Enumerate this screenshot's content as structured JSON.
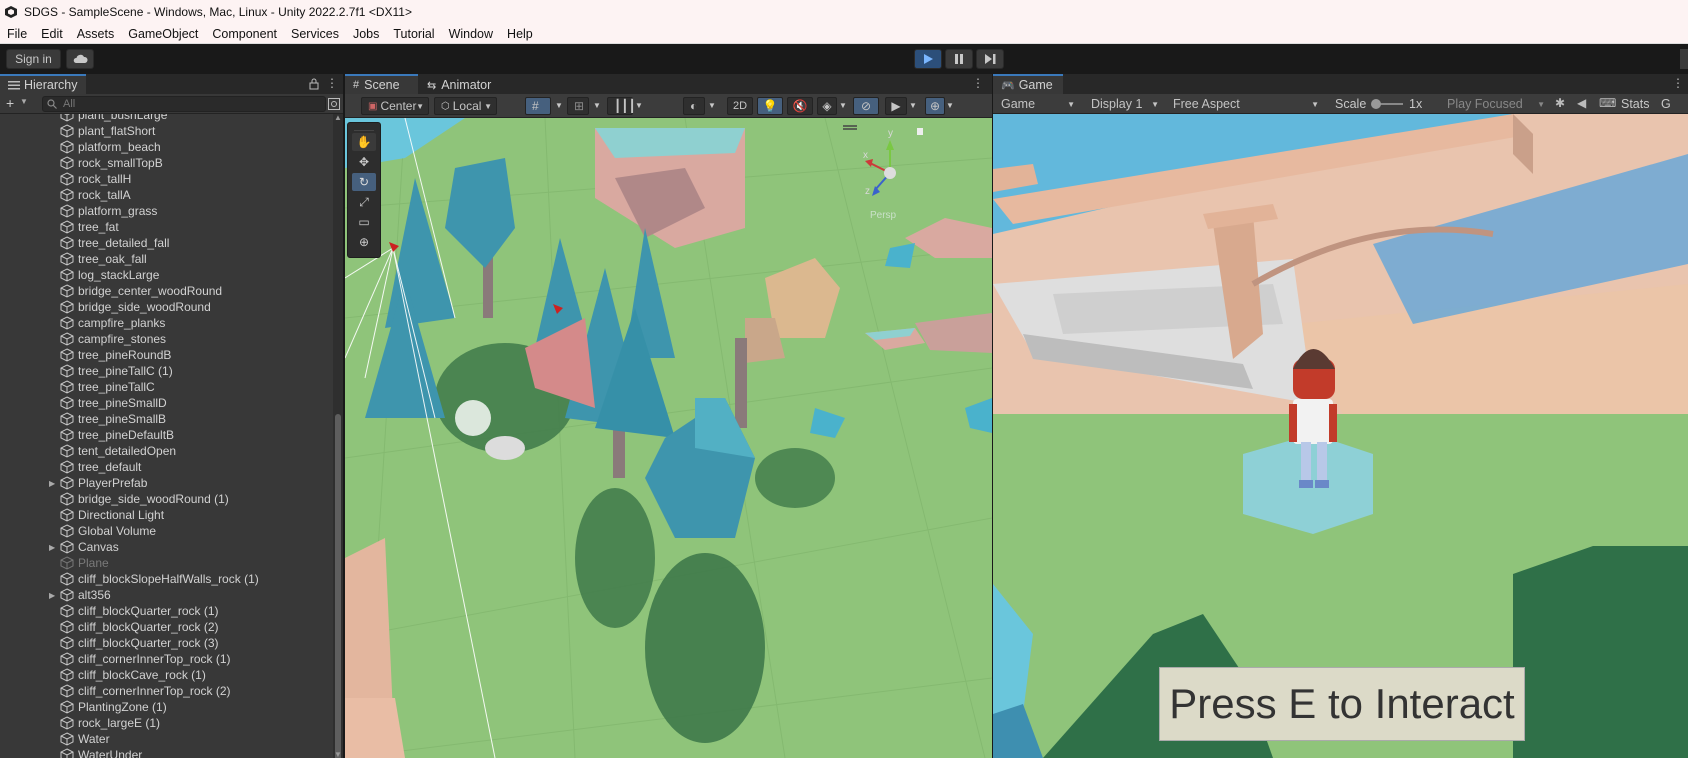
{
  "window": {
    "title": "SDGS - SampleScene - Windows, Mac, Linux - Unity 2022.2.7f1 <DX11>"
  },
  "menu": [
    "File",
    "Edit",
    "Assets",
    "GameObject",
    "Component",
    "Services",
    "Jobs",
    "Tutorial",
    "Window",
    "Help"
  ],
  "toolbar": {
    "sign_in": "Sign in"
  },
  "hierarchy": {
    "tab": "Hierarchy",
    "search_placeholder": "All",
    "items": [
      {
        "label": "plant_bushLarge",
        "expandable": false,
        "disabled": false
      },
      {
        "label": "plant_flatShort",
        "expandable": false,
        "disabled": false
      },
      {
        "label": "platform_beach",
        "expandable": false,
        "disabled": false
      },
      {
        "label": "rock_smallTopB",
        "expandable": false,
        "disabled": false
      },
      {
        "label": "rock_tallH",
        "expandable": false,
        "disabled": false
      },
      {
        "label": "rock_tallA",
        "expandable": false,
        "disabled": false
      },
      {
        "label": "platform_grass",
        "expandable": false,
        "disabled": false
      },
      {
        "label": "tree_fat",
        "expandable": false,
        "disabled": false
      },
      {
        "label": "tree_detailed_fall",
        "expandable": false,
        "disabled": false
      },
      {
        "label": "tree_oak_fall",
        "expandable": false,
        "disabled": false
      },
      {
        "label": "log_stackLarge",
        "expandable": false,
        "disabled": false
      },
      {
        "label": "bridge_center_woodRound",
        "expandable": false,
        "disabled": false
      },
      {
        "label": "bridge_side_woodRound",
        "expandable": false,
        "disabled": false
      },
      {
        "label": "campfire_planks",
        "expandable": false,
        "disabled": false
      },
      {
        "label": "campfire_stones",
        "expandable": false,
        "disabled": false
      },
      {
        "label": "tree_pineRoundB",
        "expandable": false,
        "disabled": false
      },
      {
        "label": "tree_pineTallC (1)",
        "expandable": false,
        "disabled": false
      },
      {
        "label": "tree_pineTallC",
        "expandable": false,
        "disabled": false
      },
      {
        "label": "tree_pineSmallD",
        "expandable": false,
        "disabled": false
      },
      {
        "label": "tree_pineSmallB",
        "expandable": false,
        "disabled": false
      },
      {
        "label": "tree_pineDefaultB",
        "expandable": false,
        "disabled": false
      },
      {
        "label": "tent_detailedOpen",
        "expandable": false,
        "disabled": false
      },
      {
        "label": "tree_default",
        "expandable": false,
        "disabled": false
      },
      {
        "label": "PlayerPrefab",
        "expandable": true,
        "disabled": false
      },
      {
        "label": "bridge_side_woodRound (1)",
        "expandable": false,
        "disabled": false
      },
      {
        "label": "Directional Light",
        "expandable": false,
        "disabled": false
      },
      {
        "label": "Global Volume",
        "expandable": false,
        "disabled": false
      },
      {
        "label": "Canvas",
        "expandable": true,
        "disabled": false
      },
      {
        "label": "Plane",
        "expandable": false,
        "disabled": true
      },
      {
        "label": "cliff_blockSlopeHalfWalls_rock (1)",
        "expandable": false,
        "disabled": false
      },
      {
        "label": "alt356",
        "expandable": true,
        "disabled": false
      },
      {
        "label": "cliff_blockQuarter_rock (1)",
        "expandable": false,
        "disabled": false
      },
      {
        "label": "cliff_blockQuarter_rock (2)",
        "expandable": false,
        "disabled": false
      },
      {
        "label": "cliff_blockQuarter_rock (3)",
        "expandable": false,
        "disabled": false
      },
      {
        "label": "cliff_cornerInnerTop_rock (1)",
        "expandable": false,
        "disabled": false
      },
      {
        "label": "cliff_blockCave_rock (1)",
        "expandable": false,
        "disabled": false
      },
      {
        "label": "cliff_cornerInnerTop_rock (2)",
        "expandable": false,
        "disabled": false
      },
      {
        "label": "PlantingZone (1)",
        "expandable": false,
        "disabled": false
      },
      {
        "label": "rock_largeE (1)",
        "expandable": false,
        "disabled": false
      },
      {
        "label": "Water",
        "expandable": false,
        "disabled": false
      },
      {
        "label": "WaterUnder",
        "expandable": false,
        "disabled": false
      }
    ]
  },
  "scene": {
    "tabs": [
      "Scene",
      "Animator"
    ],
    "pivot": "Center",
    "space": "Local",
    "mode_2d": "2D",
    "gizmo_persp_label": "Persp",
    "axis": {
      "x": "x",
      "y": "y",
      "z": "z"
    }
  },
  "game": {
    "tab": "Game",
    "view_select": "Game",
    "display": "Display 1",
    "aspect": "Free Aspect",
    "scale_label": "Scale",
    "scale_value": "1x",
    "play_mode": "Play Focused",
    "stats": "Stats",
    "interact_prompt": "Press E to Interact"
  },
  "colors": {
    "accent": "#3a79bb",
    "panel": "#383838",
    "grass": "#8fc47a",
    "tree": "#3e95ad",
    "trunk": "#8a7a7a",
    "sand": "#e3b69e",
    "water": "#6ac6dc"
  }
}
